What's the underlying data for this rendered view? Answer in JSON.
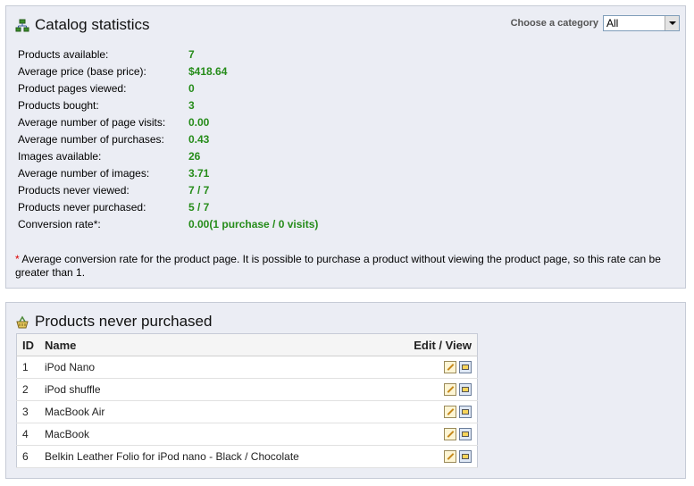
{
  "stats_panel": {
    "title": "Catalog statistics",
    "category_label": "Choose a category",
    "category_value": "All",
    "rows": [
      {
        "label": "Products available:",
        "value": "7"
      },
      {
        "label": "Average price (base price):",
        "value": "$418.64"
      },
      {
        "label": "Product pages viewed:",
        "value": "0"
      },
      {
        "label": "Products bought:",
        "value": "3"
      },
      {
        "label": "Average number of page visits:",
        "value": "0.00"
      },
      {
        "label": "Average number of purchases:",
        "value": "0.43"
      },
      {
        "label": "Images available:",
        "value": "26"
      },
      {
        "label": "Average number of images:",
        "value": "3.71"
      },
      {
        "label": "Products never viewed:",
        "value": "7 / 7"
      },
      {
        "label": "Products never purchased:",
        "value": "5 / 7"
      },
      {
        "label": "Conversion rate*:",
        "value": "0.00(1 purchase / 0 visits)"
      }
    ],
    "footnote_star": "*",
    "footnote": " Average conversion rate for the product page. It is possible to purchase a product without viewing the product page, so this rate can be greater than 1."
  },
  "never_panel": {
    "title": "Products never purchased",
    "columns": {
      "id": "ID",
      "name": "Name",
      "actions": "Edit / View"
    },
    "products": [
      {
        "id": "1",
        "name": "iPod Nano"
      },
      {
        "id": "2",
        "name": "iPod shuffle"
      },
      {
        "id": "3",
        "name": "MacBook Air"
      },
      {
        "id": "4",
        "name": "MacBook"
      },
      {
        "id": "6",
        "name": "Belkin Leather Folio for iPod nano - Black / Chocolate"
      }
    ]
  },
  "icons": {
    "stats_title": "sitemap-icon",
    "never_title": "basket-icon",
    "edit": "edit-icon",
    "view": "view-icon"
  },
  "colors": {
    "value_green": "#268c1a",
    "panel_bg": "#ebedf4",
    "footnote_star": "#dd0000"
  }
}
